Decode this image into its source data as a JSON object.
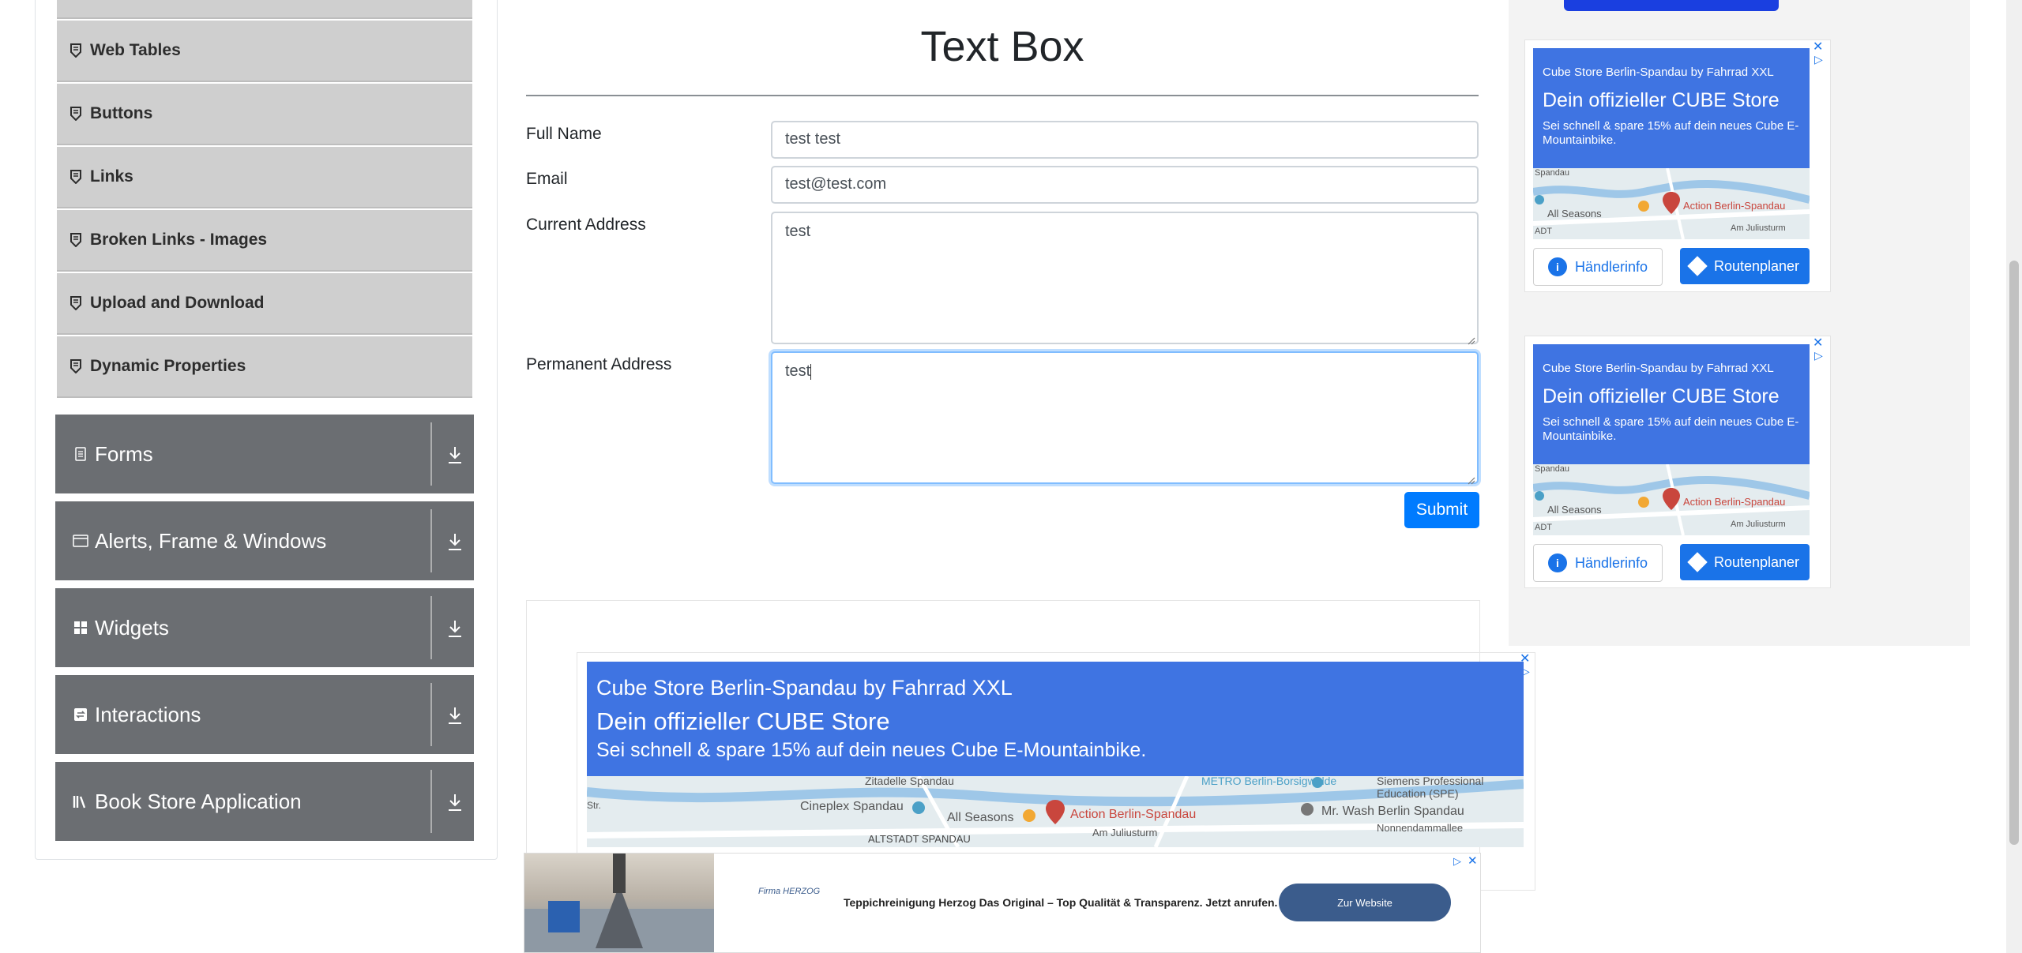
{
  "sidebar": {
    "sub_items": [
      {
        "label": "Web Tables"
      },
      {
        "label": "Buttons"
      },
      {
        "label": "Links"
      },
      {
        "label": "Broken Links - Images"
      },
      {
        "label": "Upload and Download"
      },
      {
        "label": "Dynamic Properties"
      }
    ],
    "groups": [
      {
        "label": "Forms",
        "icon": "document-icon"
      },
      {
        "label": "Alerts, Frame & Windows",
        "icon": "window-icon"
      },
      {
        "label": "Widgets",
        "icon": "widgets-icon"
      },
      {
        "label": "Interactions",
        "icon": "interactions-icon"
      },
      {
        "label": "Book Store Application",
        "icon": "books-icon"
      }
    ]
  },
  "form": {
    "title": "Text Box",
    "full_name_label": "Full Name",
    "full_name_value": "test test",
    "email_label": "Email",
    "email_value": "test@test.com",
    "current_address_label": "Current Address",
    "current_address_value": "test",
    "permanent_address_label": "Permanent Address",
    "permanent_address_value": "test",
    "submit_label": "Submit"
  },
  "side_ads": [
    {
      "advertiser": "Cube Store Berlin-Spandau by Fahrrad XXL",
      "headline": "Dein offizieller CUBE Store",
      "text": "Sei schnell & spare 15% auf dein neues Cube E-Mountainbike.",
      "map_labels": [
        "Spandau",
        "All Seasons",
        "Action Berlin-Spandau",
        "Am Juliusturm",
        "ADT"
      ],
      "info_label": "Händlerinfo",
      "route_label": "Routenplaner"
    },
    {
      "advertiser": "Cube Store Berlin-Spandau by Fahrrad XXL",
      "headline": "Dein offizieller CUBE Store",
      "text": "Sei schnell & spare 15% auf dein neues Cube E-Mountainbike.",
      "map_labels": [
        "Spandau",
        "All Seasons",
        "Action Berlin-Spandau",
        "Am Juliusturm",
        "ADT"
      ],
      "info_label": "Händlerinfo",
      "route_label": "Routenplaner"
    }
  ],
  "big_ad": {
    "advertiser": "Cube Store Berlin-Spandau by Fahrrad XXL",
    "headline": "Dein offizieller CUBE Store",
    "text": "Sei schnell & spare 15% auf dein neues Cube E-Mountainbike.",
    "map_labels": [
      "Zitadelle Spandau",
      "METRO Berlin-Borsigwalde",
      "Siemens Professional Education (SPE)",
      "Cineplex Spandau",
      "All Seasons",
      "Action Berlin-Spandau",
      "Mr. Wash Berlin Spandau",
      "Str.",
      "ALTSTADT SPANDAU",
      "Am Juliusturm",
      "Nonnendammallee"
    ]
  },
  "banner": {
    "logo": "Firma HERZOG",
    "text": "Teppichreinigung Herzog Das Original – Top Qualität & Transparenz. Jetzt anrufen.",
    "cta": "Zur Website"
  },
  "colors": {
    "primary": "#007bff",
    "sidebar_group": "#6b6e72",
    "sidebar_sub": "#cfcfcf",
    "ad_blue": "#3f74e2",
    "route_blue": "#1a73e8"
  }
}
